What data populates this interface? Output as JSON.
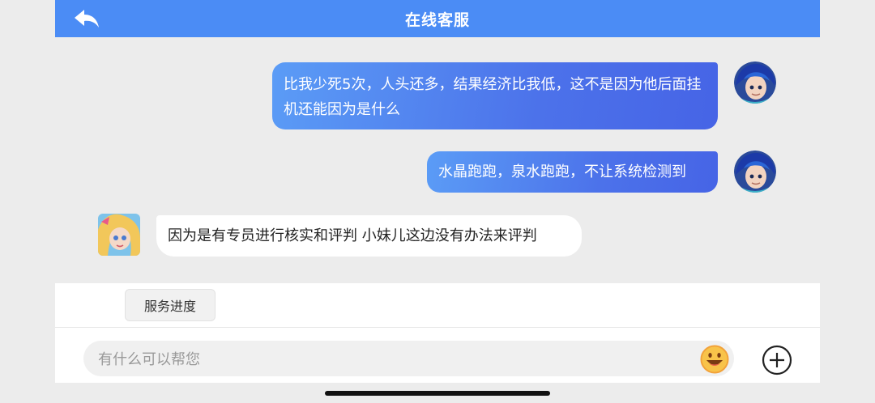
{
  "header": {
    "title": "在线客服",
    "back_icon": "back-arrow-icon"
  },
  "messages": [
    {
      "side": "outgoing",
      "text": "比我少死5次，人头还多，结果经济比我低，这不是因为他后面挂机还能因为是什么"
    },
    {
      "side": "outgoing",
      "text": "水晶跑跑，泉水跑跑，不让系统检测到"
    },
    {
      "side": "incoming",
      "text": "因为是有专员进行核实和评判 小妹儿这边没有办法来评判"
    }
  ],
  "quick_actions": [
    {
      "label": "服务进度"
    }
  ],
  "input": {
    "placeholder": "有什么可以帮您",
    "emoji_icon": "emoji-icon",
    "add_icon": "plus-circle-icon"
  },
  "colors": {
    "header": "#4b8cf5",
    "bubble_out_start": "#5b9cf6",
    "bubble_out_end": "#4664e6",
    "emoji": "#f7a62a"
  }
}
